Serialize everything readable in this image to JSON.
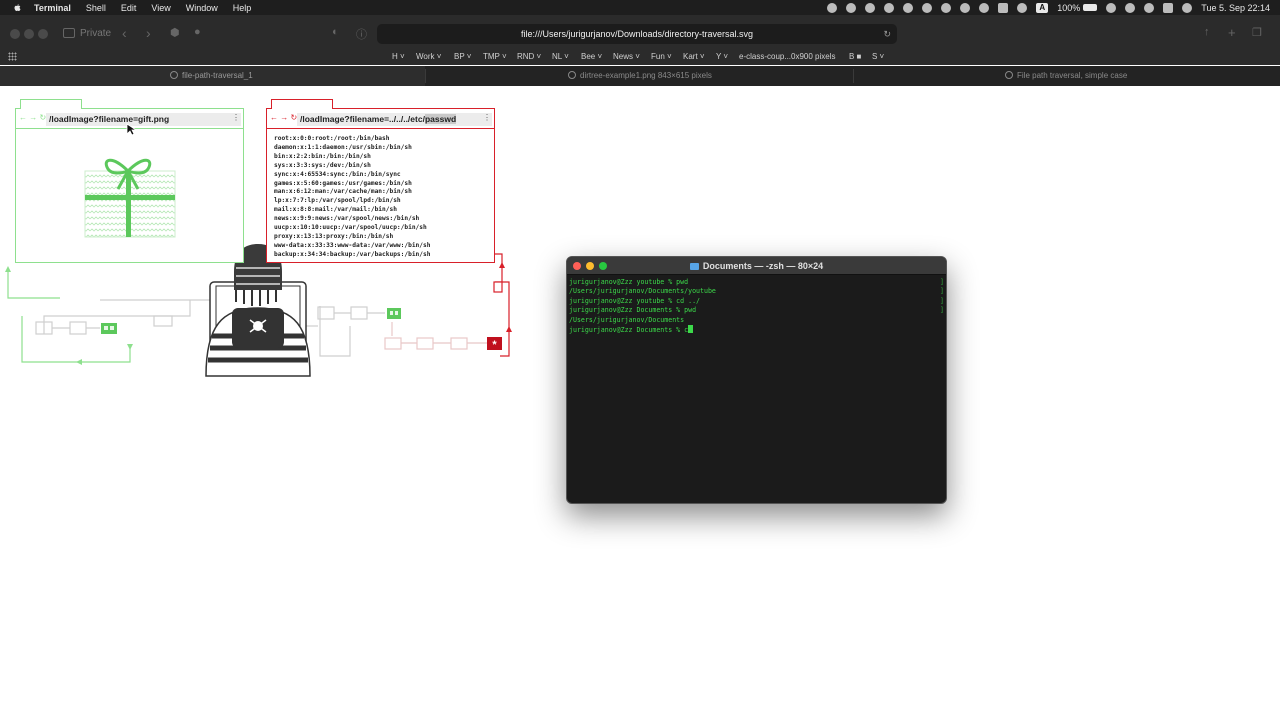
{
  "menubar": {
    "app_name": "Terminal",
    "items": [
      "Shell",
      "Edit",
      "View",
      "Window",
      "Help"
    ],
    "battery": "100%",
    "input_source": "A",
    "datetime": "Tue 5. Sep  22:14"
  },
  "browser": {
    "private_label": "Private",
    "url": "file:///Users/jurigurjanov/Downloads/directory-traversal.svg",
    "bookmarks": [
      "H ˅",
      "Work ˅",
      "BP ˅",
      "TMP ˅",
      "RND ˅",
      "NL ˅",
      "Bee ˅",
      "News ˅",
      "Fun ˅",
      "Kart ˅",
      "Y ˅",
      "e-class-coup...0x900 pixels",
      "B ■",
      "S ˅"
    ],
    "tabs": [
      {
        "label": "file-path-traversal_1"
      },
      {
        "label": "dirtree-example1.png 843×615 pixels"
      },
      {
        "label": "File path traversal, simple case"
      }
    ]
  },
  "illustration": {
    "left_url": "/loadImage?filename=gift.png",
    "right_url_prefix": "/loadImage?filename=../../../etc/",
    "right_url_selected": "passwd",
    "passwd_lines": [
      "root:x:0:0:root:/root:/bin/bash",
      "daemon:x:1:1:daemon:/usr/sbin:/bin/sh",
      "bin:x:2:2:bin:/bin:/bin/sh",
      "sys:x:3:3:sys:/dev:/bin/sh",
      "sync:x:4:65534:sync:/bin:/bin/sync",
      "games:x:5:60:games:/usr/games:/bin/sh",
      "man:x:6:12:man:/var/cache/man:/bin/sh",
      "lp:x:7:7:lp:/var/spool/lpd:/bin/sh",
      "mail:x:8:8:mail:/var/mail:/bin/sh",
      "news:x:9:9:news:/var/spool/news:/bin/sh",
      "uucp:x:10:10:uucp:/var/spool/uucp:/bin/sh",
      "proxy:x:13:13:proxy:/bin:/bin/sh",
      "www-data:x:33:33:www-data:/var/www:/bin/sh",
      "backup:x:34:34:backup:/var/backups:/bin/sh"
    ]
  },
  "terminal": {
    "title": "Documents — -zsh — 80×24",
    "lines": [
      "jurigurjanov@Zzz youtube % pwd",
      "/Users/jurigurjanov/Documents/youtube",
      "jurigurjanov@Zzz youtube % cd ../",
      "jurigurjanov@Zzz Documents % pwd",
      "/Users/jurigurjanov/Documents"
    ],
    "current_prompt": "jurigurjanov@Zzz Documents % ",
    "current_input": "c"
  },
  "colors": {
    "safe_green": "#8ee08e",
    "gift_green": "#5cc85c",
    "danger_red": "#d8202a",
    "terminal_green": "#3cd94a"
  }
}
